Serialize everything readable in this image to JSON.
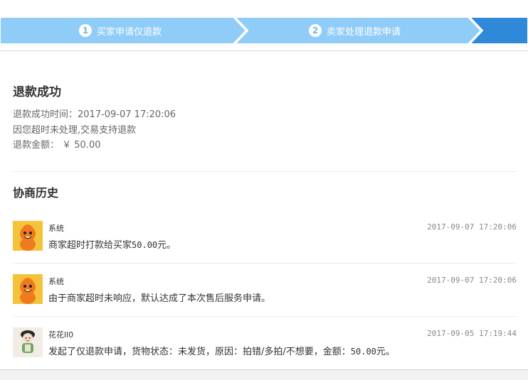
{
  "colors": {
    "step_inactive": "#8fcdf8",
    "step_active": "#2f89d8",
    "step_chevron_border": "#ffffff",
    "divider": "#d9d9d9",
    "system_avatar_bg": "#f5c33b",
    "system_avatar_face": "#f07a1e"
  },
  "steps": [
    {
      "number": "1",
      "label": "买家申请仅退款",
      "state": "completed"
    },
    {
      "number": "2",
      "label": "卖家处理退款申请",
      "state": "completed"
    },
    {
      "number": "",
      "label": "",
      "state": "current"
    }
  ],
  "result": {
    "title": "退款成功",
    "success_time": "退款成功时间：2017-09-07 17:20:06",
    "reason": "因您超时未处理,交易支持退款",
    "amount": "退款金额： ￥ 50.00"
  },
  "history": {
    "title": "协商历史",
    "entries": [
      {
        "author": "系统",
        "avatar": "system-mascot-icon",
        "time": "2017-09-07 17:20:06",
        "message_prefix": "商家超时打款给买家",
        "message_amount": "50.00",
        "message_suffix": "元。"
      },
      {
        "author": "系统",
        "avatar": "system-mascot-icon",
        "time": "2017-09-07 17:20:06",
        "message": "由于商家超时未响应，默认达成了本次售后服务申请。"
      },
      {
        "author": "花花ll0",
        "avatar": "user-avatar-icon",
        "time": "2017-09-05 17:19:44",
        "message_prefix": "发起了仅退款申请，货物状态：未发货，原因：拍错/多拍/不想要，金额：",
        "message_amount": "50.00",
        "message_suffix": "元。"
      }
    ]
  }
}
